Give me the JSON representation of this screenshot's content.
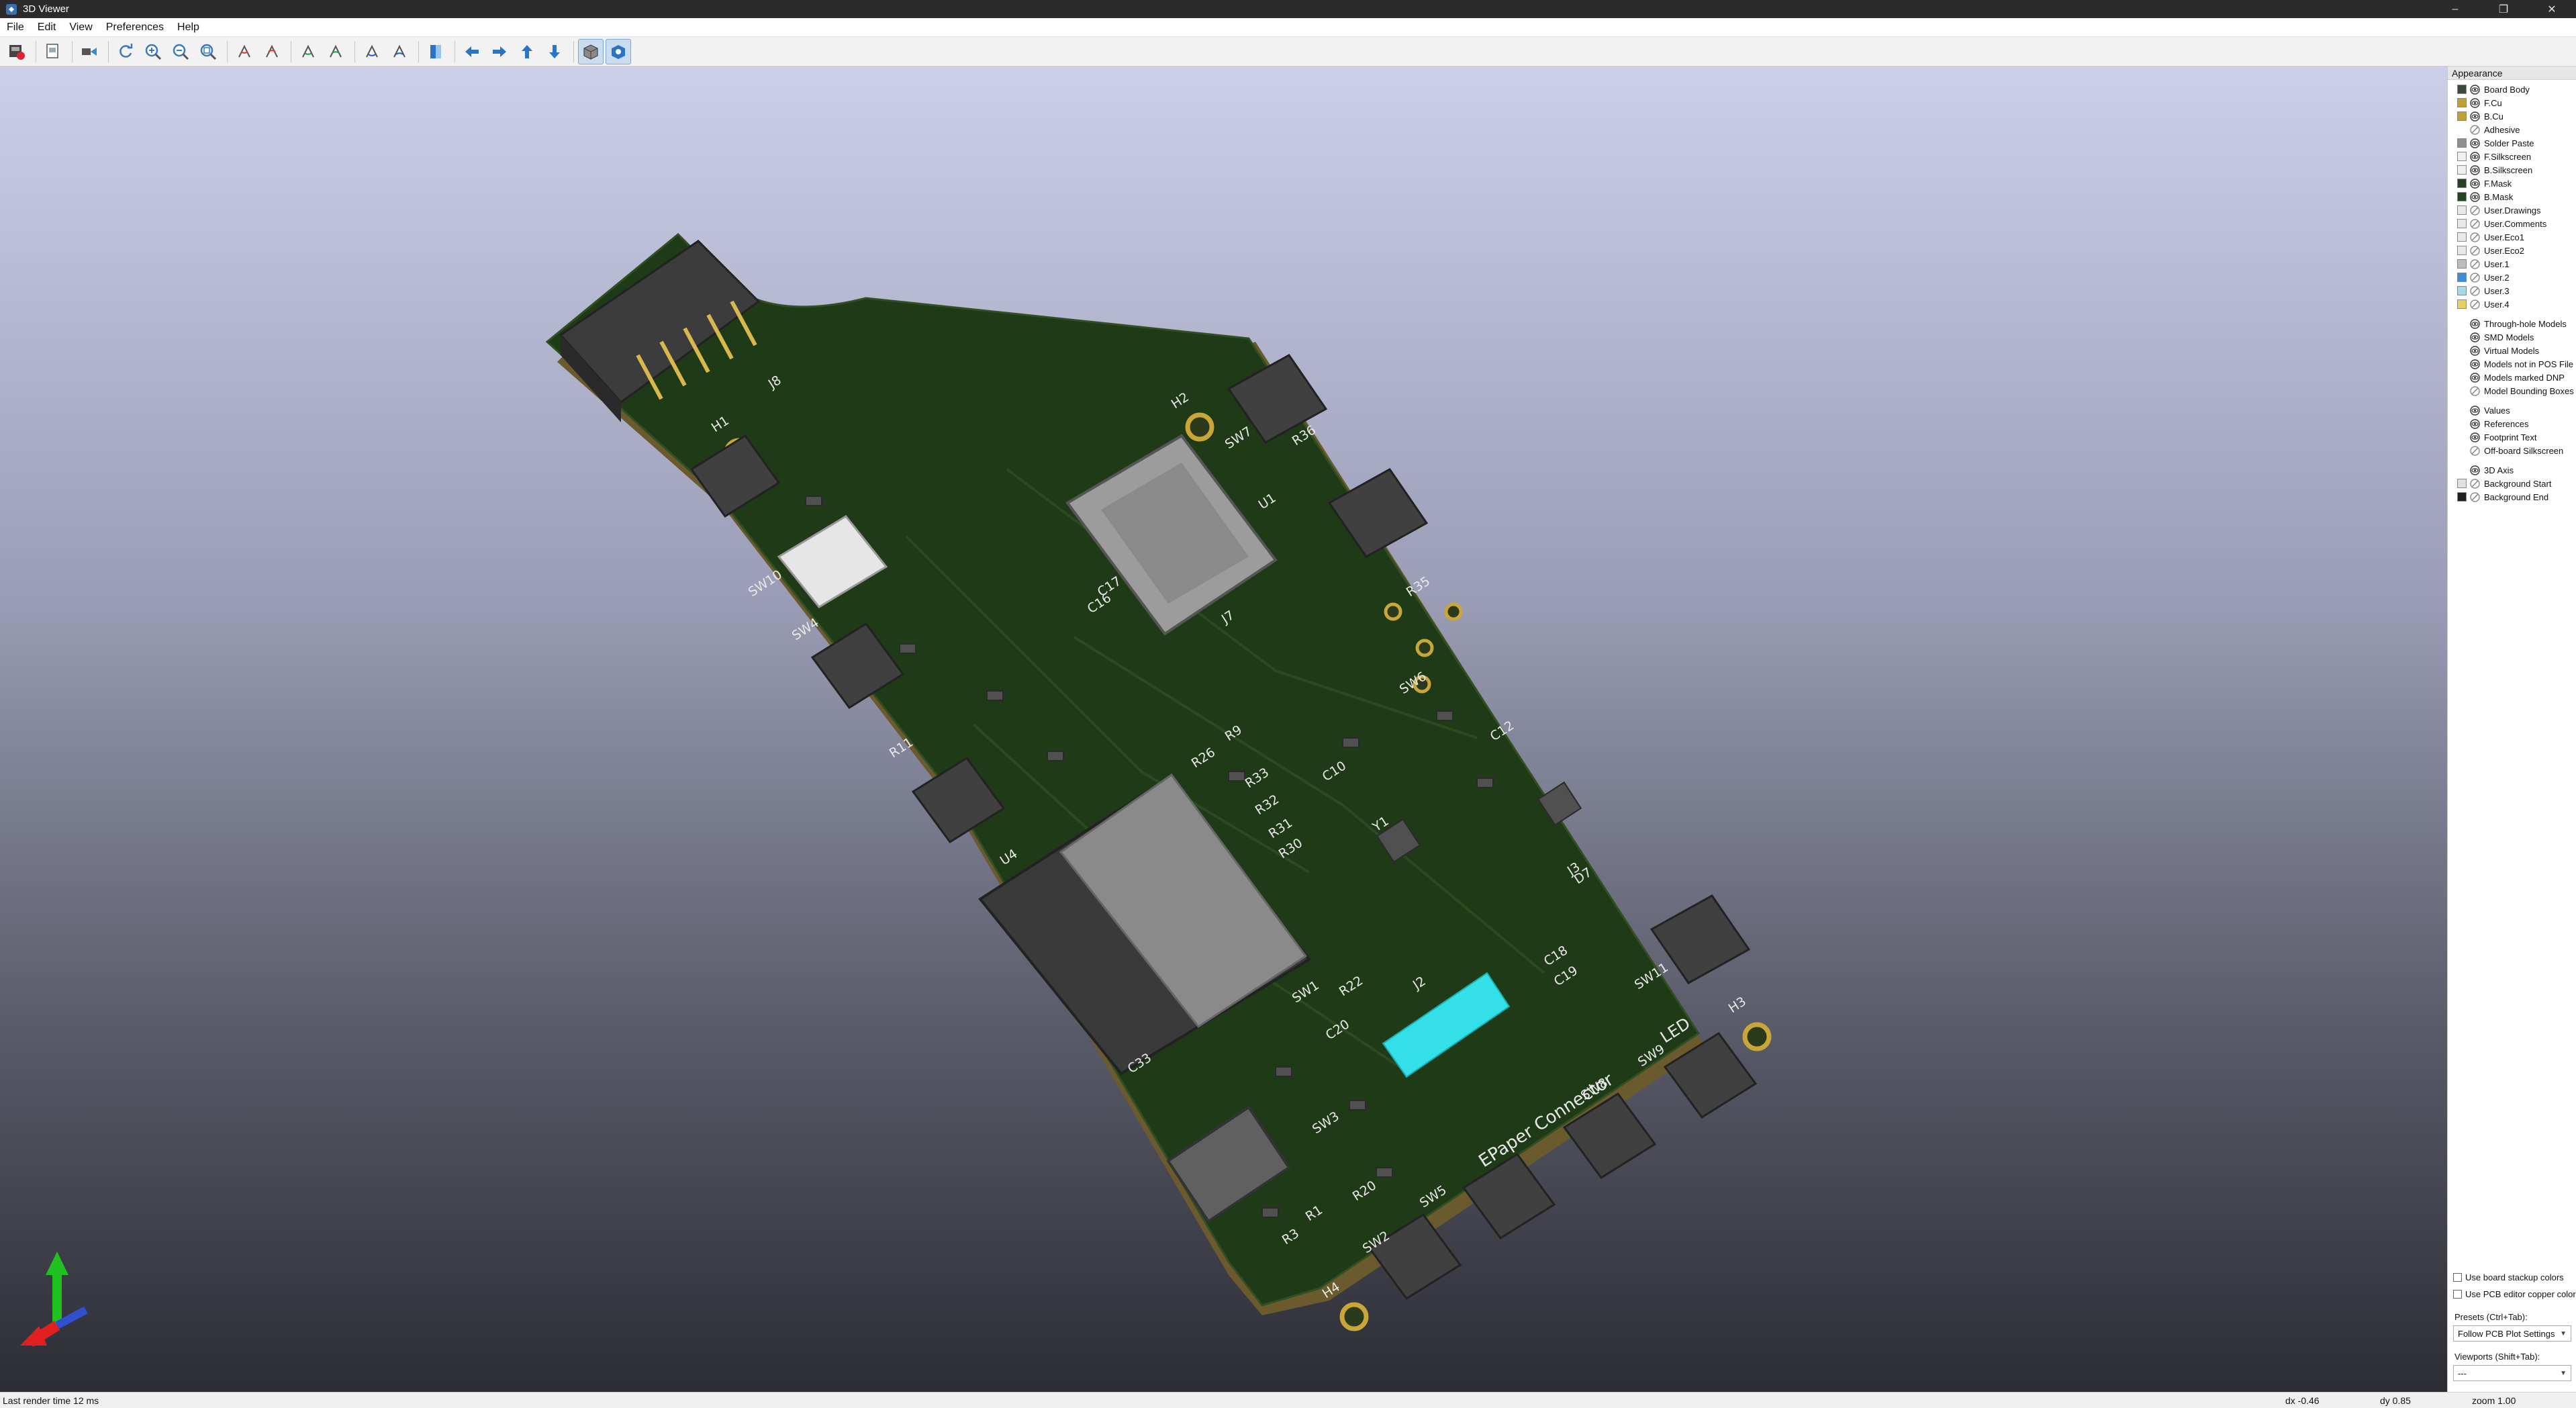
{
  "window": {
    "title": "3D Viewer",
    "controls": [
      "–",
      "❐",
      "✕"
    ]
  },
  "menu": [
    "File",
    "Edit",
    "View",
    "Preferences",
    "Help"
  ],
  "toolbar": {
    "icons": [
      "render-raytrace-icon",
      "copy-image-icon",
      "camera-icon",
      "refresh-icon",
      "zoom-in-icon",
      "zoom-out-icon",
      "zoom-fit-icon",
      "rotate-x-cw-icon",
      "rotate-x-ccw-icon",
      "rotate-y-cw-icon",
      "rotate-y-ccw-icon",
      "rotate-z-cw-icon",
      "rotate-z-ccw-icon",
      "flip-board-icon",
      "move-left-icon",
      "move-right-icon",
      "move-up-icon",
      "move-down-icon",
      "orthographic-icon",
      "layers-visibility-icon"
    ]
  },
  "board": {
    "colors": {
      "mask": "#1f3a16",
      "edge": "#7b6a3b",
      "copper": "#c9a63a",
      "cyan_part": "#33e0e8"
    },
    "labels": [
      "EPaper Connector",
      "LED",
      "H1",
      "H2",
      "H3",
      "H4",
      "J7",
      "J8",
      "U1",
      "SW1",
      "SW2",
      "SW3",
      "SW4",
      "SW5",
      "SW6",
      "SW7",
      "SW8",
      "SW9",
      "SW10",
      "SW11",
      "R36",
      "R35",
      "R26",
      "R33",
      "R32",
      "R31",
      "R30",
      "R22",
      "R20",
      "R11",
      "C10",
      "C12",
      "C16",
      "C17",
      "C18",
      "C19",
      "C20",
      "C33",
      "J3",
      "D7",
      "Y1",
      "J2",
      "U4",
      "R9",
      "R1",
      "R3"
    ]
  },
  "appearance": {
    "title": "Appearance",
    "layers": [
      {
        "label": "Board Body",
        "color": "#3a4a3a",
        "eye": true
      },
      {
        "label": "F.Cu",
        "color": "#c0a030",
        "eye": true
      },
      {
        "label": "B.Cu",
        "color": "#c0a030",
        "eye": true
      },
      {
        "label": "Adhesive",
        "color": "",
        "eye": false
      },
      {
        "label": "Solder Paste",
        "color": "#909090",
        "eye": true
      },
      {
        "label": "F.Silkscreen",
        "color": "#f0f0f0",
        "eye": true
      },
      {
        "label": "B.Silkscreen",
        "color": "#f0f0f0",
        "eye": true
      },
      {
        "label": "F.Mask",
        "color": "#224422",
        "eye": true
      },
      {
        "label": "B.Mask",
        "color": "#224422",
        "eye": true
      },
      {
        "label": "User.Drawings",
        "color": "#e8e8e8",
        "eye": false
      },
      {
        "label": "User.Comments",
        "color": "#e8e8e8",
        "eye": false
      },
      {
        "label": "User.Eco1",
        "color": "#e8e8e8",
        "eye": false
      },
      {
        "label": "User.Eco2",
        "color": "#e8e8e8",
        "eye": false
      },
      {
        "label": "User.1",
        "color": "#bcbcbc",
        "eye": false
      },
      {
        "label": "User.2",
        "color": "#3a8fd8",
        "eye": false
      },
      {
        "label": "User.3",
        "color": "#a8d8e8",
        "eye": false
      },
      {
        "label": "User.4",
        "color": "#e8d060",
        "eye": false
      }
    ],
    "models": [
      {
        "label": "Through-hole Models",
        "eye": true
      },
      {
        "label": "SMD Models",
        "eye": true
      },
      {
        "label": "Virtual Models",
        "eye": true
      },
      {
        "label": "Models not in POS File",
        "eye": true
      },
      {
        "label": "Models marked DNP",
        "eye": true
      },
      {
        "label": "Model Bounding Boxes",
        "eye": false
      }
    ],
    "text": [
      {
        "label": "Values",
        "eye": true
      },
      {
        "label": "References",
        "eye": true
      },
      {
        "label": "Footprint Text",
        "eye": true
      },
      {
        "label": "Off-board Silkscreen",
        "eye": false
      }
    ],
    "misc": [
      {
        "label": "3D Axis",
        "color": "",
        "eye": true
      },
      {
        "label": "Background Start",
        "color": "#e0e0e0",
        "eye": false
      },
      {
        "label": "Background End",
        "color": "#202020",
        "eye": false
      }
    ],
    "checkboxes": [
      "Use board stackup colors",
      "Use PCB editor copper colors"
    ],
    "presets_label": "Presets (Ctrl+Tab):",
    "presets_value": "Follow PCB Plot Settings",
    "viewports_label": "Viewports (Shift+Tab):",
    "viewports_value": "---"
  },
  "status": {
    "render_time": "Last render time 12 ms",
    "dx": "dx -0.46",
    "dy": "dy 0.85",
    "zoom": "zoom 1.00"
  }
}
